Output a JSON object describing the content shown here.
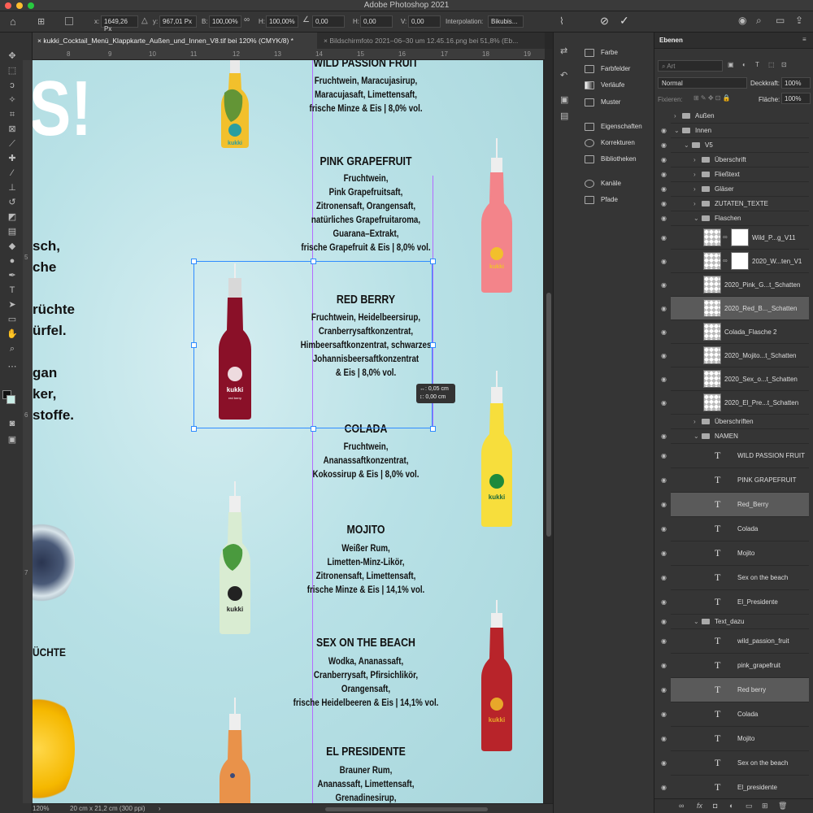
{
  "app": {
    "title": "Adobe Photoshop 2021"
  },
  "options": {
    "x_label": "x:",
    "x_value": "1649,26 Px",
    "y_label": "y:",
    "y_value": "967,01 Px",
    "b_label": "B:",
    "b_value": "100,00%",
    "h_label": "H:",
    "h_value": "100,00%",
    "angle_value": "0,00",
    "hskew_label": "H:",
    "hskew_value": "0,00",
    "vskew_label": "V:",
    "vskew_value": "0,00",
    "interp_label": "Interpolation:",
    "interp_value": "Bikubis..."
  },
  "tabs": [
    {
      "label": "kukki_Cocktail_Menü_Klappkarte_Außen_und_Innen_V8.tif bei 120% (CMYK/8) *",
      "close": "×"
    },
    {
      "label": "Bildschirmfoto 2021–06–30 um 12.45.16.png bei 51,8% (Eb...",
      "close": "×"
    }
  ],
  "ruler": [
    "8",
    "9",
    "10",
    "11",
    "12",
    "13",
    "14",
    "15",
    "16",
    "17",
    "18",
    "19"
  ],
  "ruler_v": [
    "5",
    "6",
    "7"
  ],
  "status": {
    "zoom": "120%",
    "doc": "20 cm x 21,2 cm (300 ppi)",
    "arrow": "›"
  },
  "canvas": {
    "big_s": "S!",
    "left_lines": [
      "sch,",
      "che",
      "",
      "rüchte",
      "ürfel.",
      "",
      "gan",
      "ker,",
      "stoffe."
    ],
    "fruechte": "ÜCHTE",
    "transform_tip": [
      "↔: 0,05 cm",
      "↕: 0,00 cm"
    ],
    "drinks": [
      {
        "name": "WILD PASSION FRUIT",
        "ingredients": "Fruchtwein, Maracujasirup,\nMaracujasaft, Limettensaft,\nfrische Minze & Eis | 8,0% vol."
      },
      {
        "name": "PINK GRAPEFRUIT",
        "ingredients": "Fruchtwein,\nPink Grapefruitsaft,\nZitronensaft, Orangensaft,\nnatürliches Grapefruitaroma,\nGuarana–Extrakt,\nfrische Grapefruit & Eis | 8,0% vol."
      },
      {
        "name": "RED BERRY",
        "ingredients": "Fruchtwein, Heidelbeersirup,\nCranberrysaftkonzentrat,\nHimbeersaftkonzentrat, schwarzes\nJohannisbeersaftkonzentrat\n& Eis | 8,0% vol."
      },
      {
        "name": "COLADA",
        "ingredients": "Fruchtwein,\nAnanassaftkonzentrat,\nKokossirup & Eis | 8,0% vol."
      },
      {
        "name": "MOJITO",
        "ingredients": "Weißer Rum,\nLimetten-Minz-Likör,\nZitronensaft, Limettensaft,\nfrische Minze & Eis | 14,1% vol."
      },
      {
        "name": "SEX ON THE BEACH",
        "ingredients": "Wodka, Ananassaft,\nCranberrysaft, Pfirsichlikör,\nOrangensaft,\nfrische Heidelbeeren & Eis | 14,1% vol."
      },
      {
        "name": "EL PRESIDENTE",
        "ingredients": "Brauner Rum,\nAnanassaft, Limettensaft,\nGrenadinesirup,"
      }
    ],
    "bottle_brand": "kukki",
    "bottle_subs": [
      "",
      "",
      "red berry",
      "",
      "",
      "",
      ""
    ]
  },
  "midpanel": {
    "groups": [
      [
        "Farbe",
        "Farbfelder",
        "Verläufe",
        "Muster"
      ],
      [
        "Eigenschaften",
        "Korrekturen",
        "Bibliotheken"
      ],
      [
        "Kanäle",
        "Pfade"
      ]
    ]
  },
  "layers": {
    "tab": "Ebenen",
    "search": "Art",
    "blend": "Normal",
    "opacity_label": "Deckkraft:",
    "opacity": "100%",
    "lock_label": "Fixieren:",
    "fill_label": "Fläche:",
    "fill": "100%",
    "rows": [
      {
        "name": "Außen",
        "kind": "folder",
        "indent": 0
      },
      {
        "name": "Innen",
        "kind": "folder",
        "indent": 0
      },
      {
        "name": "V5",
        "kind": "folder",
        "indent": 1
      },
      {
        "name": "Überschrift",
        "kind": "folder",
        "indent": 2
      },
      {
        "name": "Fließtext",
        "kind": "folder",
        "indent": 2
      },
      {
        "name": "Gläser",
        "kind": "folder",
        "indent": 2
      },
      {
        "name": "ZUTATEN_TEXTE",
        "kind": "folder",
        "indent": 2
      },
      {
        "name": "Flaschen",
        "kind": "folder",
        "indent": 2
      },
      {
        "name": "Wild_P...g_V11",
        "kind": "mask",
        "indent": 3
      },
      {
        "name": "2020_W...ten_V1",
        "kind": "mask",
        "indent": 3
      },
      {
        "name": "2020_Pink_G...t_Schatten",
        "kind": "img",
        "indent": 3
      },
      {
        "name": "2020_Red_B..._Schatten",
        "kind": "img",
        "indent": 3,
        "sel": true
      },
      {
        "name": "Colada_Flasche 2",
        "kind": "img",
        "indent": 3
      },
      {
        "name": "2020_Mojito...t_Schatten",
        "kind": "img",
        "indent": 3
      },
      {
        "name": "2020_Sex_o...t_Schatten",
        "kind": "img",
        "indent": 3
      },
      {
        "name": "2020_El_Pre...t_Schatten",
        "kind": "img",
        "indent": 3
      },
      {
        "name": "Überschriften",
        "kind": "folder",
        "indent": 2
      },
      {
        "name": "NAMEN",
        "kind": "folder",
        "indent": 2
      },
      {
        "name": "WILD PASSION FRUIT",
        "kind": "text",
        "indent": 3
      },
      {
        "name": "PINK GRAPEFRUIT",
        "kind": "text",
        "indent": 3
      },
      {
        "name": "Red_Berry",
        "kind": "text",
        "indent": 3,
        "sel": true
      },
      {
        "name": "Colada",
        "kind": "text",
        "indent": 3
      },
      {
        "name": "Mojito",
        "kind": "text",
        "indent": 3
      },
      {
        "name": "Sex on the beach",
        "kind": "text",
        "indent": 3
      },
      {
        "name": "El_Presidente",
        "kind": "text",
        "indent": 3
      },
      {
        "name": "Text_dazu",
        "kind": "folder",
        "indent": 2
      },
      {
        "name": "wild_passion_fruit",
        "kind": "text",
        "indent": 3
      },
      {
        "name": "pink_grapefruit",
        "kind": "text",
        "indent": 3
      },
      {
        "name": "Red berry",
        "kind": "text",
        "indent": 3,
        "sel": true
      },
      {
        "name": "Colada",
        "kind": "text",
        "indent": 3
      },
      {
        "name": "Mojito",
        "kind": "text",
        "indent": 3
      },
      {
        "name": "Sex on the beach",
        "kind": "text",
        "indent": 3
      },
      {
        "name": "El_presidente",
        "kind": "text",
        "indent": 3
      }
    ],
    "footer": "fx"
  },
  "colors": {
    "selection": "#2f8cff",
    "guide": "#b36bff",
    "canvas": "#b8e1e6"
  }
}
